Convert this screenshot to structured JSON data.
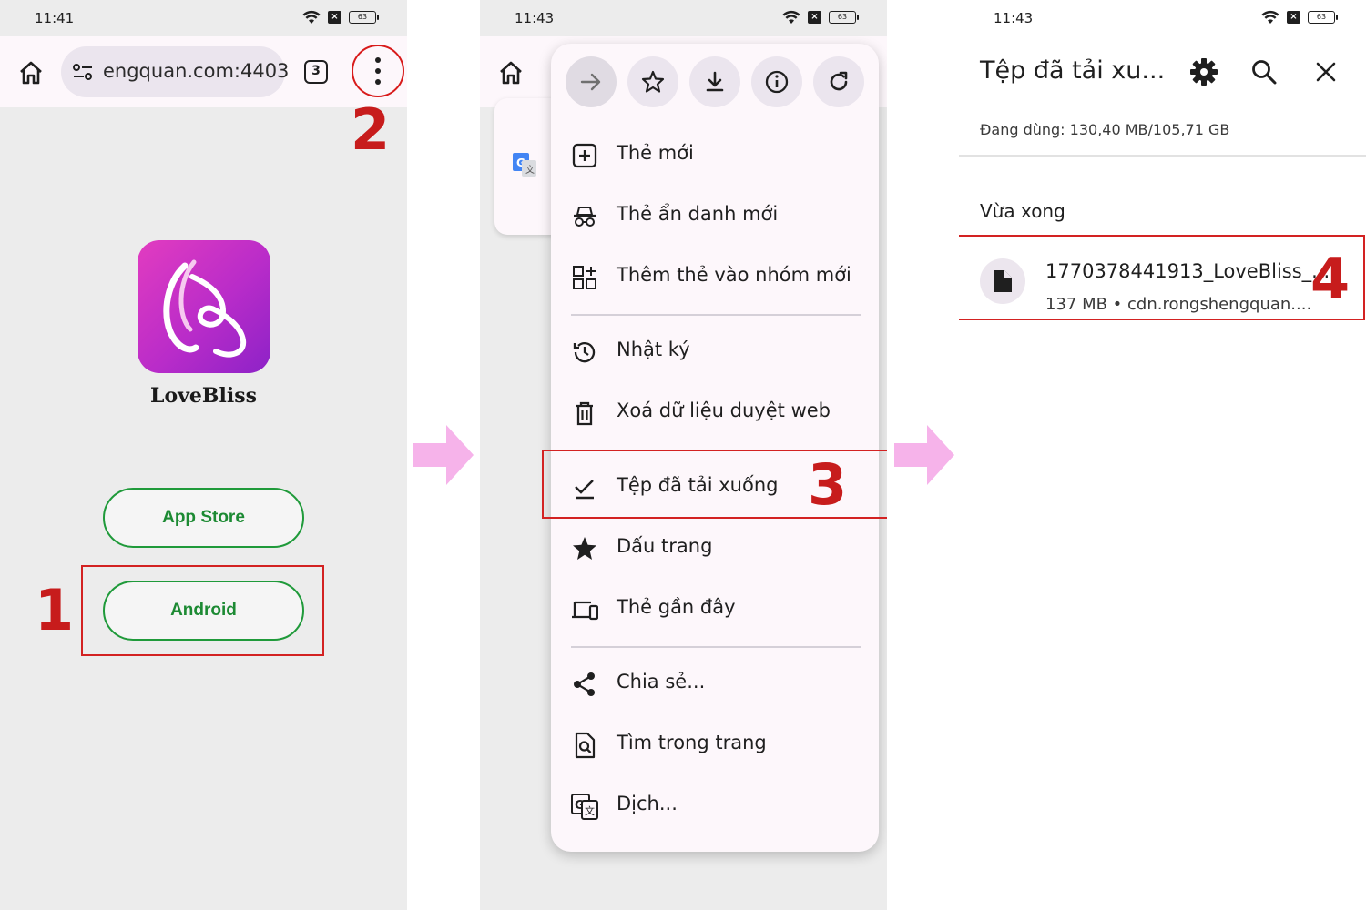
{
  "panel1": {
    "status_time": "11:41",
    "battery": "63",
    "url": "engquan.com:4403",
    "tab_count": "3",
    "app_name": "LoveBliss",
    "buttons": {
      "app_store": "App Store",
      "android": "Android"
    },
    "steps": {
      "one": "1",
      "two": "2"
    }
  },
  "panel2": {
    "status_time": "11:43",
    "battery": "63",
    "menu_items": [
      {
        "label": "Thẻ mới",
        "icon": "new-tab-icon"
      },
      {
        "label": "Thẻ ẩn danh mới",
        "icon": "incognito-icon"
      },
      {
        "label": "Thêm thẻ vào nhóm mới",
        "icon": "tab-group-icon"
      },
      {
        "label": "Nhật ký",
        "icon": "history-icon"
      },
      {
        "label": "Xoá dữ liệu duyệt web",
        "icon": "trash-icon"
      },
      {
        "label": "Tệp đã tải xuống",
        "icon": "downloads-check-icon"
      },
      {
        "label": "Dấu trang",
        "icon": "star-icon"
      },
      {
        "label": "Thẻ gần đây",
        "icon": "devices-icon"
      },
      {
        "label": "Chia sẻ...",
        "icon": "share-icon"
      },
      {
        "label": "Tìm trong trang",
        "icon": "find-in-page-icon"
      },
      {
        "label": "Dịch...",
        "icon": "translate-icon"
      }
    ],
    "step": "3"
  },
  "panel3": {
    "status_time": "11:43",
    "battery": "63",
    "title": "Tệp đã tải xu...",
    "storage": "Đang dùng: 130,40 MB/105,71 GB",
    "section": "Vừa xong",
    "file_name": "1770378441913_LoveBliss_...",
    "file_meta": "137 MB • cdn.rongshengquan....",
    "step": "4"
  },
  "colors": {
    "highlight_red": "#d32222",
    "android_green": "#1f9a3a",
    "arrow_pink": "#f6b3ea",
    "logo_magenta": "#c22fc4"
  }
}
